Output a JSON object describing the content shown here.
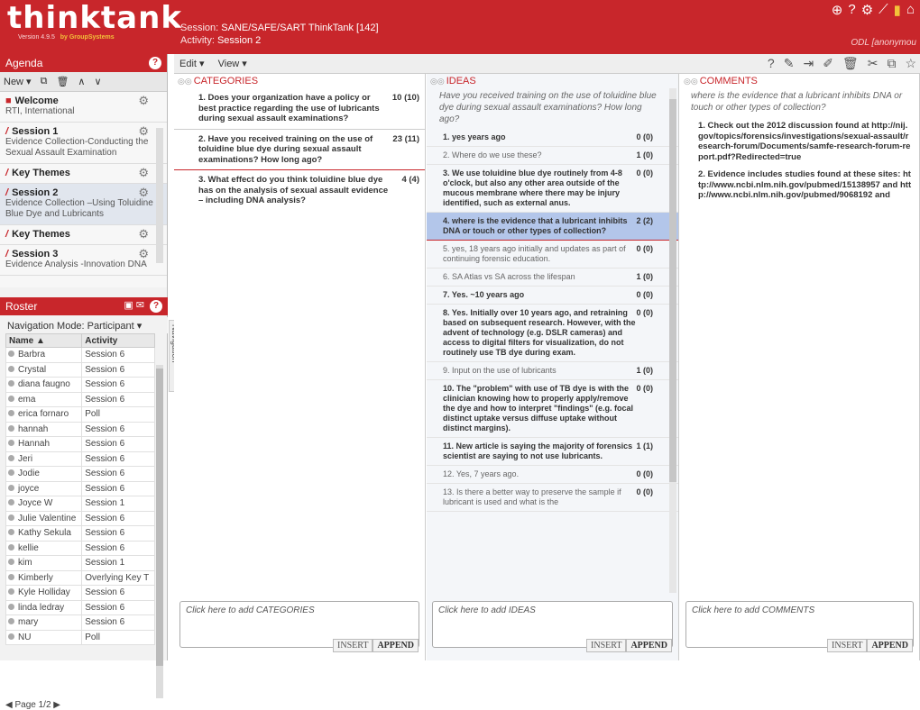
{
  "header": {
    "logo_text": "thinktank",
    "version": "Version 4.9.5",
    "vendor": "by GroupSystems",
    "session_label": "Session:",
    "session_value": "SANE/SAFE/SART ThinkTank [142]",
    "activity_label": "Activity:",
    "activity_value": "Session 2",
    "user": "ODL [anonymou",
    "icons": [
      "globe-icon",
      "help-icon",
      "gear-icon",
      "chart-icon",
      "signal-icon",
      "home-icon"
    ]
  },
  "agenda": {
    "title": "Agenda",
    "toolbar": {
      "new_label": "New ▾"
    },
    "items": [
      {
        "title": "Welcome",
        "subtitle": "RTI, International"
      },
      {
        "title": "Session 1",
        "subtitle": "Evidence Collection-Conducting the Sexual Assault Examination"
      },
      {
        "title": "Key Themes",
        "subtitle": ""
      },
      {
        "title": "Session 2",
        "subtitle": "Evidence Collection –Using Toluidine Blue Dye and Lubricants"
      },
      {
        "title": "Key Themes",
        "subtitle": ""
      },
      {
        "title": "Session 3",
        "subtitle": "Evidence Analysis -Innovation DNA"
      }
    ]
  },
  "roster": {
    "title": "Roster",
    "nav_mode": "Navigation Mode:  Participant ▾",
    "columns": [
      "Name",
      "Activity"
    ],
    "rows": [
      [
        "Barbra",
        "Session 6"
      ],
      [
        "Crystal",
        "Session 6"
      ],
      [
        "diana faugno",
        "Session 6"
      ],
      [
        "ema",
        "Session 6"
      ],
      [
        "erica fornaro",
        "Poll"
      ],
      [
        "hannah",
        "Session 6"
      ],
      [
        "Hannah",
        "Session 6"
      ],
      [
        "Jeri",
        "Session 6"
      ],
      [
        "Jodie",
        "Session 6"
      ],
      [
        "joyce",
        "Session 6"
      ],
      [
        "Joyce W",
        "Session 1"
      ],
      [
        "Julie Valentine",
        "Session 6"
      ],
      [
        "Kathy Sekula",
        "Session 6"
      ],
      [
        "kellie",
        "Session 6"
      ],
      [
        "kim",
        "Session 1"
      ],
      [
        "Kimberly",
        "Overlying Key T"
      ],
      [
        "Kyle Holliday",
        "Session 6"
      ],
      [
        "linda ledray",
        "Session 6"
      ],
      [
        "mary",
        "Session 6"
      ],
      [
        "NU",
        "Poll"
      ]
    ],
    "pager": "Page 1/2"
  },
  "navigation_tab": "Navigation",
  "toolbar": {
    "edit": "Edit ▾",
    "view": "View ▾"
  },
  "categories": {
    "title": "CATEGORIES",
    "items": [
      {
        "text": "1.  Does your organization have a policy or best practice regarding the use of lubricants during sexual assault examinations?",
        "count": "10 (10)"
      },
      {
        "text": "2.  Have you received training on the use of toluidine blue dye during sexual assault examinations? How long ago?",
        "count": "23 (11)"
      },
      {
        "text": "3.  What effect do you think toluidine blue dye has on the analysis of sexual assault evidence – including DNA analysis?",
        "count": "4 (4)"
      }
    ],
    "add_placeholder": "Click here to add CATEGORIES"
  },
  "ideas": {
    "title": "IDEAS",
    "prompt": "Have you received training on the use of toluidine blue dye during sexual assault examinations? How long ago?",
    "items": [
      {
        "text": "1.  yes years ago",
        "count": "0 (0)"
      },
      {
        "text": "2.  Where do we use these?",
        "count": "1 (0)"
      },
      {
        "text": "3.  We use toluidine blue dye routinely from 4-8 o'clock, but also any other area outside of the mucous membrane where there may be injury identified, such as external anus.",
        "count": "0 (0)"
      },
      {
        "text": "4.  where is the evidence that a lubricant inhibits DNA or touch or other types of collection?",
        "count": "2 (2)"
      },
      {
        "text": "5.  yes, 18 years ago initially and updates as part of continuing forensic education.",
        "count": "0 (0)"
      },
      {
        "text": "6.  SA Atlas vs SA across the lifespan",
        "count": "1 (0)"
      },
      {
        "text": "7.  Yes. ~10 years ago",
        "count": "0 (0)"
      },
      {
        "text": "8.  Yes. Initially over 10 years ago, and retraining based on subsequent research. However, with the advent of technology (e.g. DSLR cameras) and access to digital filters for visualization, do not routinely use TB dye during exam.",
        "count": "0 (0)"
      },
      {
        "text": "9.  Input on the use of lubricants",
        "count": "1 (0)"
      },
      {
        "text": "10.  The \"problem\" with use of TB dye is with the clinician knowing how to properly apply/remove the dye and how to interpret \"findings\" (e.g. focal distinct uptake versus diffuse uptake without distinct margins).",
        "count": "0 (0)"
      },
      {
        "text": "11.  New article is saying the majority of forensics scientist are saying to not use lubricants.",
        "count": "1 (1)"
      },
      {
        "text": "12.  Yes, 7 years ago.",
        "count": "0 (0)"
      },
      {
        "text": "13.  Is there a better way to preserve the sample if lubricant is used and what is the",
        "count": "0 (0)"
      }
    ],
    "add_placeholder": "Click here to add IDEAS"
  },
  "comments": {
    "title": "COMMENTS",
    "prompt": "where is the evidence that a lubricant inhibits DNA or touch or other types of collection?",
    "items": [
      {
        "text": "1.  Check out the 2012 discussion found at http://nij.gov/topics/forensics/investigations/sexual-assault/research-forum/Documents/samfe-research-forum-report.pdf?Redirected=true"
      },
      {
        "text": "2.  Evidence includes studies found at these sites: http://www.ncbi.nlm.nih.gov/pubmed/15138957 and http://www.ncbi.nlm.nih.gov/pubmed/9068192 and"
      }
    ],
    "add_placeholder": "Click here to add COMMENTS"
  },
  "buttons": {
    "insert": "INSERT",
    "append": "APPEND"
  }
}
